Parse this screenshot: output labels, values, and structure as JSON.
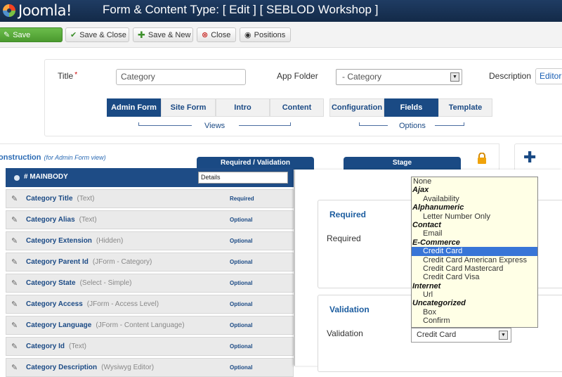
{
  "header": {
    "logo_text": "Joomla!",
    "title": "Form & Content Type: [ Edit ] [ SEBLOD Workshop ]"
  },
  "toolbar": {
    "save": "Save",
    "save_close": "Save & Close",
    "save_new": "Save & New",
    "close": "Close",
    "positions": "Positions"
  },
  "form": {
    "title_label": "Title",
    "title_value": "Category",
    "app_folder_label": "App Folder",
    "app_folder_value": "- Category",
    "description_label": "Description",
    "editor_button": "Editor"
  },
  "views_tabs": [
    "Admin Form",
    "Site Form",
    "Intro",
    "Content"
  ],
  "views_label": "Views",
  "options_tabs": [
    "Configuration",
    "Fields",
    "Template"
  ],
  "options_label": "Options",
  "construction": {
    "title": "onstruction",
    "subtitle": "(for Admin Form view)",
    "col_required": "Required / Validation",
    "col_stage": "Stage",
    "mainbody_label": "# MAINBODY",
    "details_value": "Details"
  },
  "fields": [
    {
      "name": "Category Title",
      "type": "(Text)",
      "status": "Required"
    },
    {
      "name": "Category Alias",
      "type": "(Text)",
      "status": "Optional"
    },
    {
      "name": "Category Extension",
      "type": "(Hidden)",
      "status": "Optional"
    },
    {
      "name": "Category Parent Id",
      "type": "(JForm - Category)",
      "status": "Optional"
    },
    {
      "name": "Category State",
      "type": "(Select - Simple)",
      "status": "Optional"
    },
    {
      "name": "Category Access",
      "type": "(JForm - Access Level)",
      "status": "Optional"
    },
    {
      "name": "Category Language",
      "type": "(JForm - Content Language)",
      "status": "Optional"
    },
    {
      "name": "Category Id",
      "type": "(Text)",
      "status": "Optional"
    },
    {
      "name": "Category Description",
      "type": "(Wysiwyg Editor)",
      "status": "Optional"
    }
  ],
  "side_panel": {
    "required_title": "Required",
    "required_label": "Required",
    "validation_title": "Validation",
    "validation_label": "Validation",
    "validation_value": "Credit Card"
  },
  "dropdown_options": [
    {
      "label": "None",
      "kind": "plain"
    },
    {
      "label": "Ajax",
      "kind": "group"
    },
    {
      "label": "Availability",
      "kind": "item"
    },
    {
      "label": "Alphanumeric",
      "kind": "group"
    },
    {
      "label": "Letter Number Only",
      "kind": "item"
    },
    {
      "label": "Contact",
      "kind": "group"
    },
    {
      "label": "Email",
      "kind": "item"
    },
    {
      "label": "E-Commerce",
      "kind": "group"
    },
    {
      "label": "Credit Card",
      "kind": "item",
      "selected": true
    },
    {
      "label": "Credit Card American Express",
      "kind": "item"
    },
    {
      "label": "Credit Card Mastercard",
      "kind": "item"
    },
    {
      "label": "Credit Card Visa",
      "kind": "item"
    },
    {
      "label": "Internet",
      "kind": "group"
    },
    {
      "label": "Url",
      "kind": "item"
    },
    {
      "label": "Uncategorized",
      "kind": "group"
    },
    {
      "label": "Box",
      "kind": "item"
    },
    {
      "label": "Confirm",
      "kind": "item"
    }
  ],
  "colors": {
    "header_bg": "#1b3558",
    "accent": "#1a4a84",
    "save_green": "#5aa83c",
    "selected_option": "#3875d7",
    "dropdown_bg": "#ffffe6"
  }
}
